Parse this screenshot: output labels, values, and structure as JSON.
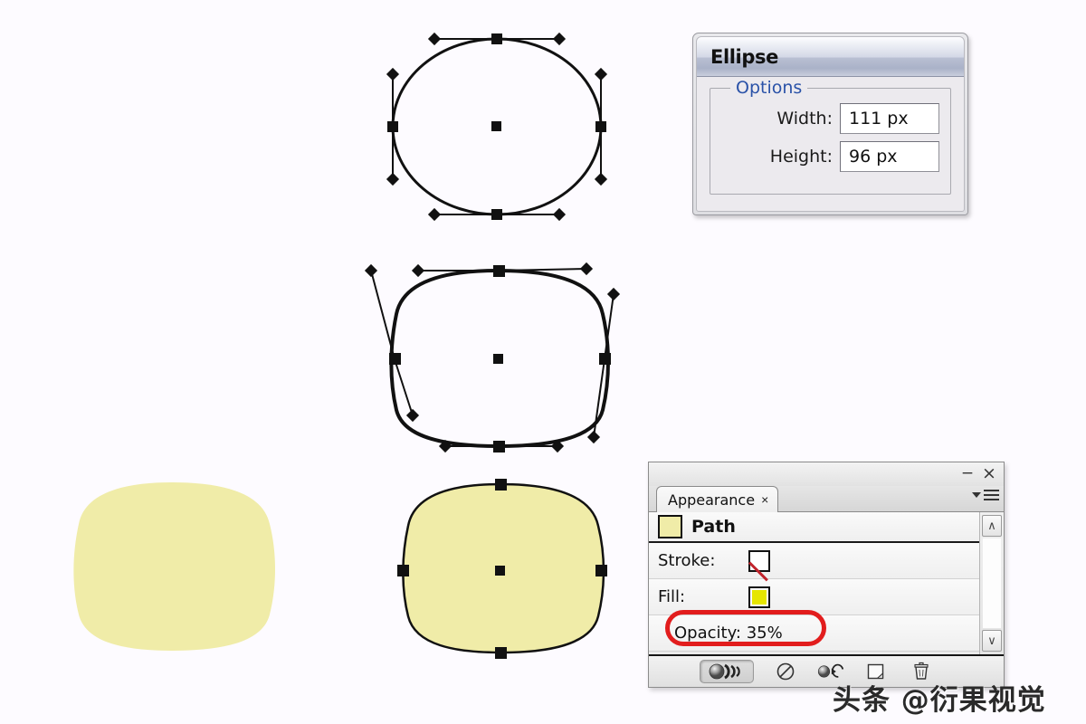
{
  "app": {
    "background_color": "#fdfbff",
    "accent_red": "#e21d1d",
    "shape_fill": "#f0eca8",
    "fill_swatch_color": "#e6e600"
  },
  "ellipse_dialog": {
    "title": "Ellipse",
    "options_legend": "Options",
    "fields": [
      {
        "label": "Width:",
        "value": "111 px"
      },
      {
        "label": "Height:",
        "value": "96 px"
      }
    ]
  },
  "appearance_panel": {
    "minimize_label": "−",
    "close_label": "×",
    "tab": {
      "label": "Appearance",
      "close_label": "×"
    },
    "path_row": {
      "label": "Path"
    },
    "rows": [
      {
        "label": "Stroke:",
        "swatch": "none"
      },
      {
        "label": "Fill:",
        "swatch": "yellow"
      }
    ],
    "opacity_row": {
      "label": "Opacity: 35%"
    },
    "scroll": {
      "up": "∧",
      "down": "∨"
    },
    "footer_buttons": [
      "add-new-effect-button",
      "clear-appearance-button",
      "reduce-to-basic-appearance-button",
      "duplicate-selected-item-button",
      "delete-selected-item-button"
    ]
  },
  "artwork": {
    "shapes": [
      {
        "name": "ellipse-path-outline",
        "fill": "none",
        "stroke": "#111111"
      },
      {
        "name": "rounded-lens-path-outline",
        "fill": "none",
        "stroke": "#111111"
      },
      {
        "name": "filled-lens-shape-no-stroke",
        "fill": "#f0eca8",
        "stroke": "none"
      },
      {
        "name": "filled-lens-shape-selected",
        "fill": "#f0eca8",
        "stroke": "#111111"
      }
    ]
  },
  "watermark": {
    "text": "头条 @衍果视觉"
  }
}
